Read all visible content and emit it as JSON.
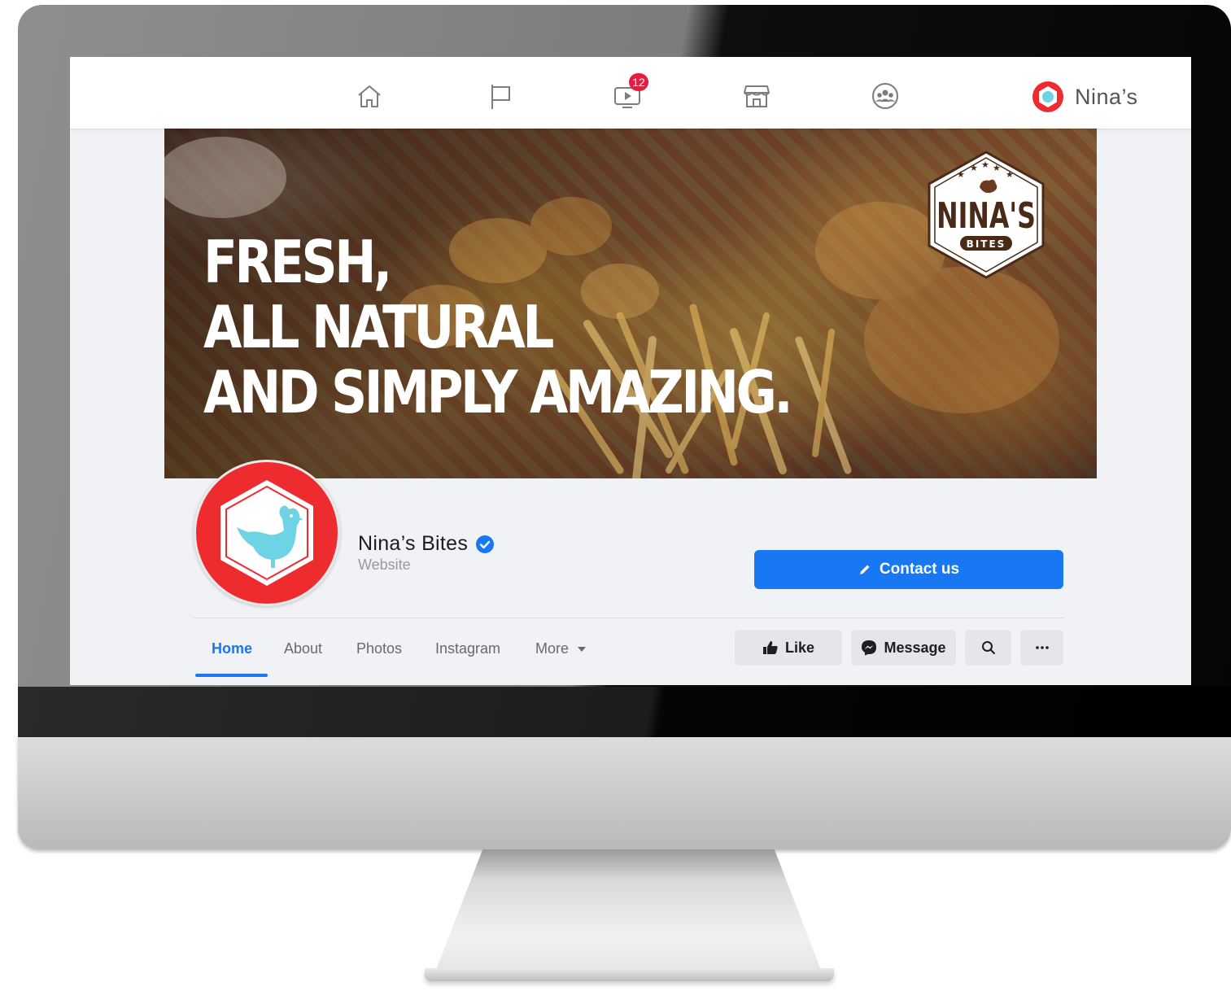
{
  "topnav": {
    "items": [
      {
        "icon": "home-icon"
      },
      {
        "icon": "flag-icon"
      },
      {
        "icon": "watch-icon",
        "badge": "12"
      },
      {
        "icon": "marketplace-icon"
      },
      {
        "icon": "groups-icon"
      }
    ],
    "profile_name": "Nina’s"
  },
  "cover": {
    "headline": [
      "FRESH,",
      "ALL NATURAL",
      "AND SIMPLY AMAZING."
    ],
    "logo_text": "NINA'S",
    "logo_subtext": "BITES"
  },
  "page": {
    "name": "Nina’s Bites",
    "category": "Website",
    "contact_label": "Contact us"
  },
  "tabs": [
    "Home",
    "About",
    "Photos",
    "Instagram",
    "More"
  ],
  "actions": {
    "like": "Like",
    "message": "Message"
  },
  "colors": {
    "brand_blue": "#1877f2",
    "brand_red": "#ee2c30",
    "logo_brown": "#4a2a17",
    "chicken_blue": "#6fd3e6"
  }
}
